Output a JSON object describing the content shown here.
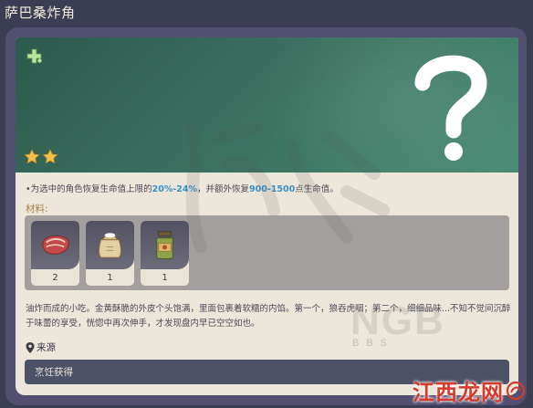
{
  "window": {
    "title": "萨巴桑炸角"
  },
  "banner": {
    "rarity_stars": 2
  },
  "effect": {
    "prefix": "•为选中的角色恢复生命值上限的",
    "pct": "20%-24%",
    "mid": "，并额外恢复",
    "hp": "900-1500",
    "suffix": "点生命值。"
  },
  "materials": {
    "label": "材料:",
    "items": [
      {
        "name": "raw-meat",
        "count": "2"
      },
      {
        "name": "flour",
        "count": "1"
      },
      {
        "name": "jam-jar",
        "count": "1"
      }
    ]
  },
  "description": "油炸而成的小吃。金黄酥脆的外皮个头饱满，里面包裹着软糯的内馅。第一个，狼吞虎咽；第二个，细细品味...不知不觉间沉醉于味蕾的享受，恍惚中再次伸手，才发现盘内早已空空如也。",
  "source": {
    "label": "来源",
    "entries": [
      "烹饪获得"
    ]
  },
  "watermarks": {
    "ngb": "NGB",
    "ngb_sub": "BBS",
    "corner": "江西龙网"
  },
  "colors": {
    "accent_blue": "#3a90c8",
    "materials_gold": "#a9824a",
    "star_gold": "#f4c146",
    "plus_green": "#b8e6a0"
  }
}
